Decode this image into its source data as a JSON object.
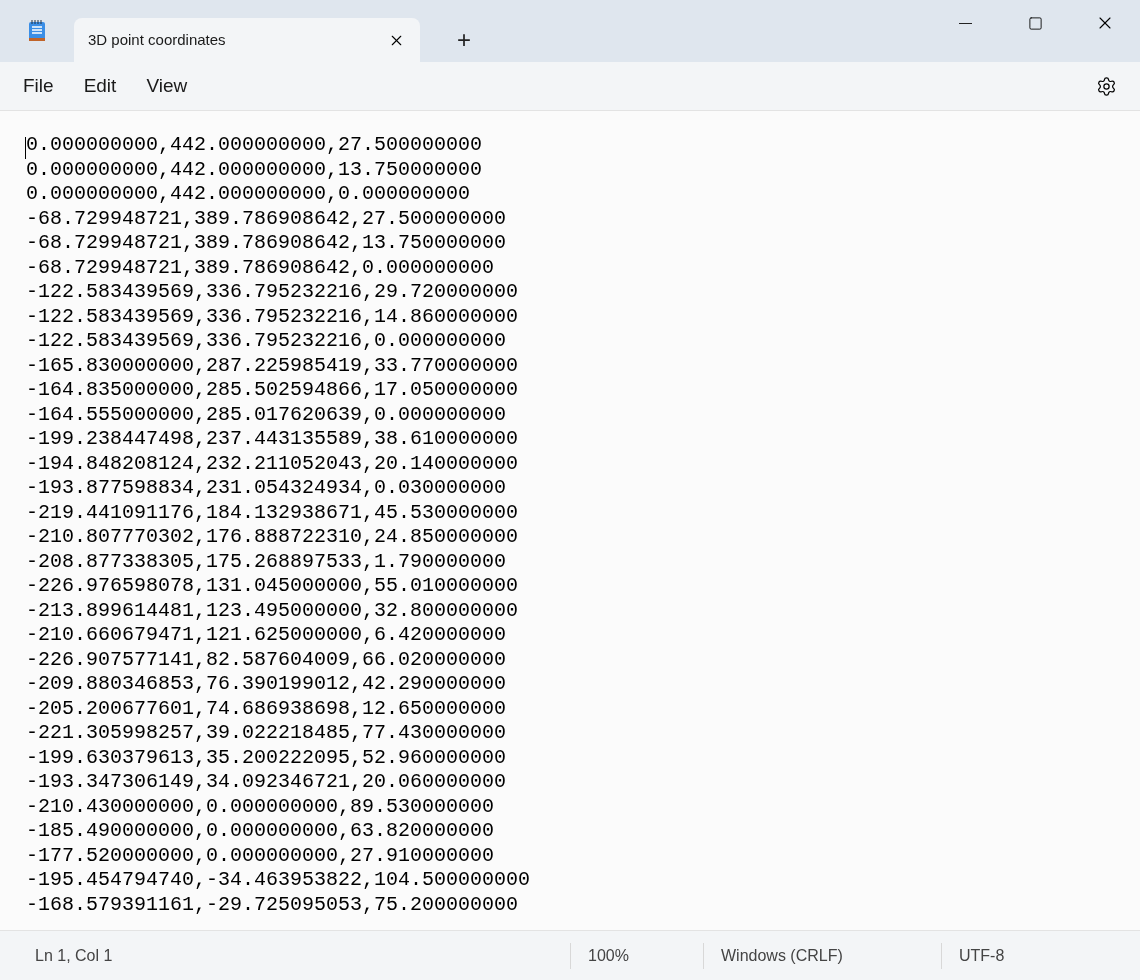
{
  "window": {
    "tab_title": "3D point coordinates",
    "new_tab": "+"
  },
  "menu": [
    "File",
    "Edit",
    "View"
  ],
  "lines": [
    "0.000000000,442.000000000,27.500000000",
    "0.000000000,442.000000000,13.750000000",
    "0.000000000,442.000000000,0.000000000",
    "-68.729948721,389.786908642,27.500000000",
    "-68.729948721,389.786908642,13.750000000",
    "-68.729948721,389.786908642,0.000000000",
    "-122.583439569,336.795232216,29.720000000",
    "-122.583439569,336.795232216,14.860000000",
    "-122.583439569,336.795232216,0.000000000",
    "-165.830000000,287.225985419,33.770000000",
    "-164.835000000,285.502594866,17.050000000",
    "-164.555000000,285.017620639,0.000000000",
    "-199.238447498,237.443135589,38.610000000",
    "-194.848208124,232.211052043,20.140000000",
    "-193.877598834,231.054324934,0.030000000",
    "-219.441091176,184.132938671,45.530000000",
    "-210.807770302,176.888722310,24.850000000",
    "-208.877338305,175.268897533,1.790000000",
    "-226.976598078,131.045000000,55.010000000",
    "-213.899614481,123.495000000,32.800000000",
    "-210.660679471,121.625000000,6.420000000",
    "-226.907577141,82.587604009,66.020000000",
    "-209.880346853,76.390199012,42.290000000",
    "-205.200677601,74.686938698,12.650000000",
    "-221.305998257,39.022218485,77.430000000",
    "-199.630379613,35.200222095,52.960000000",
    "-193.347306149,34.092346721,20.060000000",
    "-210.430000000,0.000000000,89.530000000",
    "-185.490000000,0.000000000,63.820000000",
    "-177.520000000,0.000000000,27.910000000",
    "-195.454794740,-34.463953822,104.500000000",
    "-168.579391161,-29.725095053,75.200000000"
  ],
  "status_bar": [
    "Ln 1, Col 1",
    "100%",
    "Windows (CRLF)",
    "UTF-8"
  ]
}
